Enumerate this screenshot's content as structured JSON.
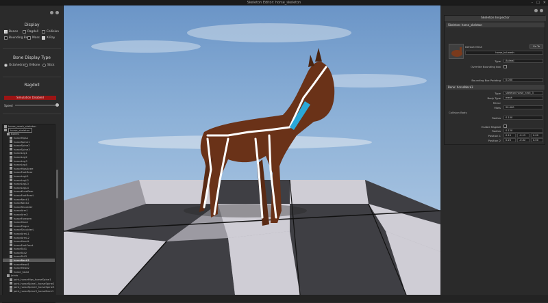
{
  "window": {
    "title": "Skeleton Editor: horse_skeleton",
    "menu": "File"
  },
  "display": {
    "title": "Display",
    "options": [
      {
        "label": "Bones",
        "checked": true
      },
      {
        "label": "Ragdoll",
        "checked": false
      },
      {
        "label": "Collision",
        "checked": false
      },
      {
        "label": "Bounding Box",
        "checked": false
      },
      {
        "label": "Mass",
        "checked": false
      },
      {
        "label": "X-Ray",
        "checked": true
      }
    ]
  },
  "bone_display": {
    "title": "Bone Display Type",
    "options": [
      {
        "label": "Octahedral",
        "selected": true
      },
      {
        "label": "B-Bone",
        "selected": false
      },
      {
        "label": "Stick",
        "selected": false
      }
    ]
  },
  "ragdoll": {
    "title": "Ragdoll",
    "status": "Simulation Disabled",
    "speed_label": "Speed",
    "speed_value": 1.0
  },
  "tree": {
    "rows": [
      {
        "label": "horse_mesh_skeleton",
        "indent": 0,
        "selected": false,
        "edit": false
      },
      {
        "label": "horse_skeleton",
        "indent": 0,
        "selected": false,
        "edit": true
      },
      {
        "label": "Bones",
        "indent": 1,
        "selected": false,
        "edit": false
      },
      {
        "label": "horseHips1",
        "indent": 2,
        "selected": false,
        "edit": false
      },
      {
        "label": "horseSpine1",
        "indent": 2,
        "selected": false,
        "edit": false
      },
      {
        "label": "horseSpine2",
        "indent": 2,
        "selected": false,
        "edit": false
      },
      {
        "label": "horseSpine3",
        "indent": 2,
        "selected": false,
        "edit": false
      },
      {
        "label": "horseLeg1",
        "indent": 2,
        "selected": false,
        "edit": false
      },
      {
        "label": "horseLeg2",
        "indent": 2,
        "selected": false,
        "edit": false
      },
      {
        "label": "horseLeg3",
        "indent": 2,
        "selected": false,
        "edit": false
      },
      {
        "label": "horseLeg4",
        "indent": 2,
        "selected": false,
        "edit": false
      },
      {
        "label": "horseHipsKnee",
        "indent": 2,
        "selected": false,
        "edit": false
      },
      {
        "label": "horseFootRear",
        "indent": 2,
        "selected": false,
        "edit": false
      },
      {
        "label": "horseLegL1",
        "indent": 2,
        "selected": false,
        "edit": false
      },
      {
        "label": "horseLegL2",
        "indent": 2,
        "selected": false,
        "edit": false
      },
      {
        "label": "horseLegL3",
        "indent": 2,
        "selected": false,
        "edit": false
      },
      {
        "label": "horseLegL4",
        "indent": 2,
        "selected": false,
        "edit": false
      },
      {
        "label": "horseKneeRear",
        "indent": 2,
        "selected": false,
        "edit": false
      },
      {
        "label": "horseFootRearL",
        "indent": 2,
        "selected": false,
        "edit": false
      },
      {
        "label": "horseNeck1",
        "indent": 2,
        "selected": false,
        "edit": false
      },
      {
        "label": "horseNeck2",
        "indent": 2,
        "selected": false,
        "edit": false
      },
      {
        "label": "horseShoulder",
        "indent": 2,
        "selected": false,
        "edit": false
      },
      {
        "label": "horseArm1",
        "indent": 2,
        "selected": false,
        "edit": false
      },
      {
        "label": "horseArm2",
        "indent": 2,
        "selected": false,
        "edit": false
      },
      {
        "label": "horseForearm",
        "indent": 2,
        "selected": false,
        "edit": false
      },
      {
        "label": "horseHand",
        "indent": 2,
        "selected": false,
        "edit": false
      },
      {
        "label": "horseFinger",
        "indent": 2,
        "selected": false,
        "edit": false
      },
      {
        "label": "horseShoulderL",
        "indent": 2,
        "selected": false,
        "edit": false
      },
      {
        "label": "horseArmL1",
        "indent": 2,
        "selected": false,
        "edit": false
      },
      {
        "label": "horseArmL2",
        "indent": 2,
        "selected": false,
        "edit": false
      },
      {
        "label": "horseHandL",
        "indent": 2,
        "selected": false,
        "edit": false
      },
      {
        "label": "horseFootFront",
        "indent": 2,
        "selected": false,
        "edit": false
      },
      {
        "label": "horseTail1",
        "indent": 2,
        "selected": false,
        "edit": false
      },
      {
        "label": "horseTail2",
        "indent": 2,
        "selected": false,
        "edit": false
      },
      {
        "label": "horseTail3",
        "indent": 2,
        "selected": false,
        "edit": false
      },
      {
        "label": "horseNeck3",
        "indent": 2,
        "selected": true,
        "edit": false
      },
      {
        "label": "horseHead1",
        "indent": 2,
        "selected": false,
        "edit": false
      },
      {
        "label": "horseHead2",
        "indent": 2,
        "selected": false,
        "edit": false
      },
      {
        "label": "horse_head",
        "indent": 2,
        "selected": false,
        "edit": false
      },
      {
        "label": "Joints",
        "indent": 1,
        "selected": false,
        "edit": false
      },
      {
        "label": "joint_horseHips_horseSpine1",
        "indent": 2,
        "selected": false,
        "edit": false
      },
      {
        "label": "joint_horseSpine1_horseSpine2",
        "indent": 2,
        "selected": false,
        "edit": false
      },
      {
        "label": "joint_horseSpine2_horseSpine3",
        "indent": 2,
        "selected": false,
        "edit": false
      },
      {
        "label": "joint_horseSpine3_horseNeck1",
        "indent": 2,
        "selected": false,
        "edit": false
      }
    ]
  },
  "inspector": {
    "title": "Skeleton Inspector",
    "skeleton_header": "Skeleton: horse_skeleton",
    "default_mesh_label": "Default Mesh",
    "go_to_label": "Go To",
    "mesh_value": "horse_hd.mesh",
    "type_label": "Type",
    "type_value": "Animal",
    "override_label": "Override Bounding box",
    "bbox_padding_label": "Bounding Box Padding",
    "bbox_padding_value": "0.000",
    "bone_header": "Bone: horseNeck3",
    "bone_type_label": "Type",
    "bone_type_value": "skeleton:horse_neck_3",
    "body_type_label": "Body Type",
    "body_type_value": "mesh",
    "mirror_label": "Mirror",
    "mass_label": "Mass",
    "mass_value": "20.000",
    "collision_body_label": "Collision Body",
    "radius_label": "Radius",
    "radius_value": "0.100",
    "max_radius_label": "Max Radius",
    "max_radius_value": "0.100",
    "position1_label": "Position 1",
    "position1": [
      "0.10",
      "-0.15",
      "0.00"
    ],
    "position2_label": "Position 2",
    "position2": [
      "0.20",
      "-0.02",
      "0.00"
    ],
    "ragdoll_body_label": "Ragdoll Body",
    "enable_ragdoll_label": "Enable Ragdoll",
    "rag_radius_label": "Radius",
    "rag_radius_value": "0.120",
    "rag_position1_label": "Position 1",
    "rag_position1": [
      "0.10",
      "-0.15",
      "0.00"
    ],
    "rag_position2_label": "Position 2",
    "rag_position2": [
      "0.20",
      "-0.02",
      "0.00"
    ]
  },
  "colors": {
    "ragdoll_red": "#9c1414",
    "bone_cyan": "#2aa8d8",
    "sky": "#8eb2d8"
  }
}
